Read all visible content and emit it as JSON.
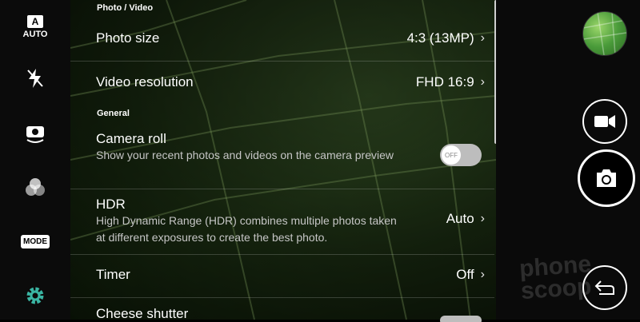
{
  "left_rail": {
    "auto_badge": "A",
    "auto_label": "AUTO",
    "mode_label": "MODE"
  },
  "sections": {
    "photo_video": "Photo / Video",
    "general": "General"
  },
  "rows": {
    "photo_size": {
      "title": "Photo size",
      "value": "4:3 (13MP)"
    },
    "video_resolution": {
      "title": "Video resolution",
      "value": "FHD 16:9"
    },
    "camera_roll": {
      "title": "Camera roll",
      "desc": "Show your recent photos and videos on the camera preview",
      "toggle": "OFF"
    },
    "hdr": {
      "title": "HDR",
      "desc": "High Dynamic Range (HDR) combines multiple photos taken at different exposures to create the best photo.",
      "value": "Auto"
    },
    "timer": {
      "title": "Timer",
      "value": "Off"
    },
    "cheese_shutter": {
      "title": "Cheese shutter"
    }
  },
  "watermark": "phone scoop",
  "icons": {
    "left_rail": [
      "auto-icon",
      "flash-off-icon",
      "switch-camera-icon",
      "filter-icon",
      "mode-icon",
      "settings-gear-icon"
    ],
    "right_rail": [
      "gallery-thumbnail",
      "video-record-icon",
      "camera-shutter-icon",
      "back-arrow-icon"
    ]
  },
  "colors": {
    "accent": "#3ab5a3"
  }
}
